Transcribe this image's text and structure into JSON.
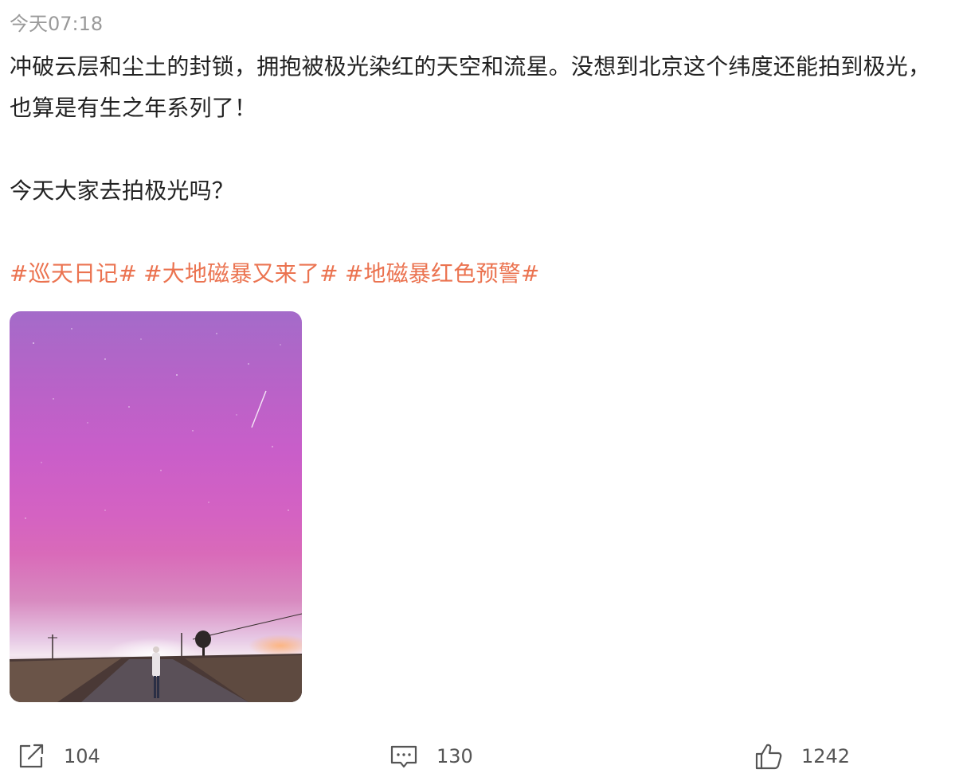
{
  "post": {
    "timestamp": "今天07:18",
    "paragraphs": [
      "冲破云层和尘土的封锁，拥抱被极光染红的天空和流星。没想到北京这个纬度还能拍到极光，也算是有生之年系列了！",
      "今天大家去拍极光吗？"
    ],
    "tags": [
      "#巡天日记#",
      "#大地磁暴又来了#",
      "#地磁暴红色预警#"
    ],
    "tag_color": "#eb7350",
    "image": {
      "icon": "aurora-photo"
    }
  },
  "actions": {
    "share": {
      "icon": "share-icon",
      "count": "104"
    },
    "comment": {
      "icon": "comment-icon",
      "count": "130"
    },
    "like": {
      "icon": "thumbs-up-icon",
      "count": "1242"
    }
  }
}
